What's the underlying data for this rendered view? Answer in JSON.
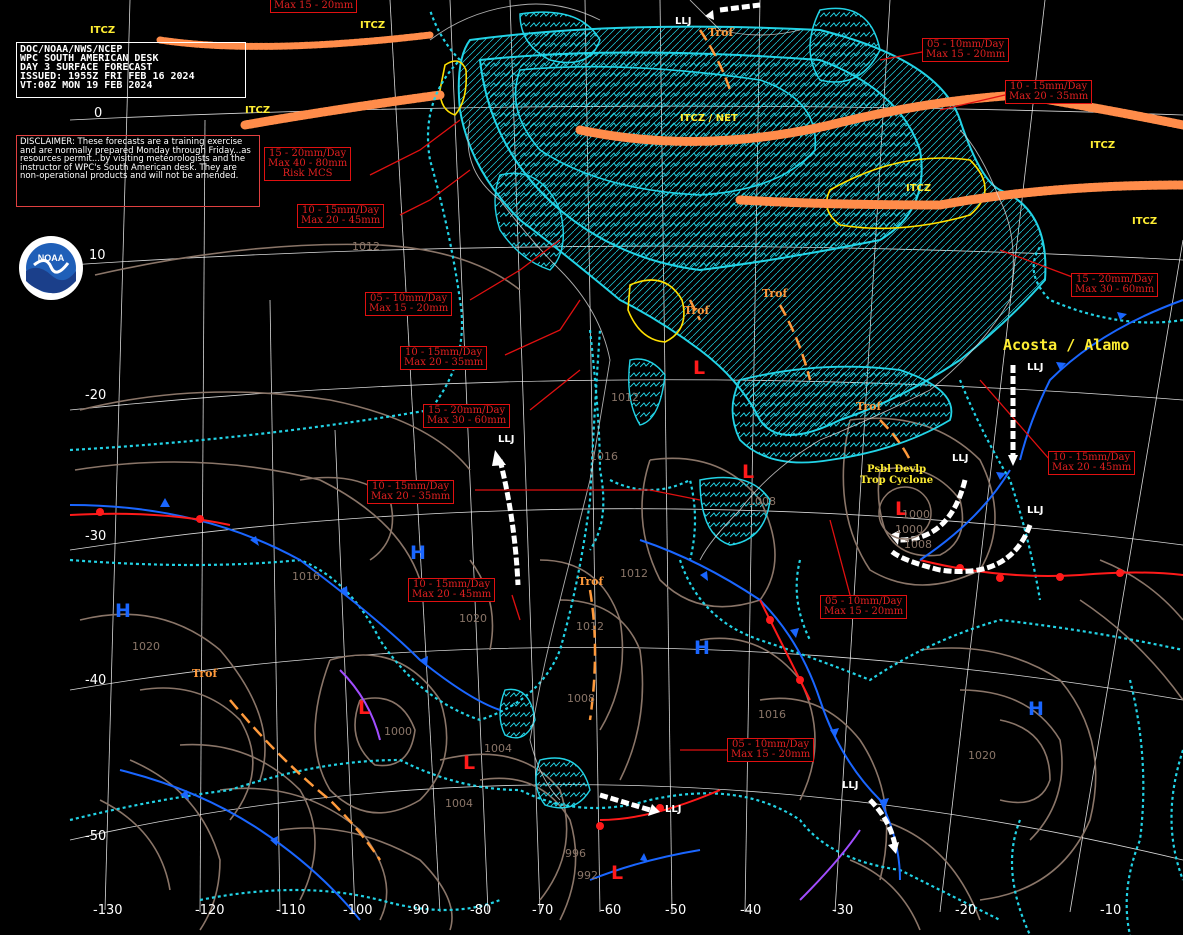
{
  "header": {
    "line1": "DOC/NOAA/NWS/NCEP",
    "line2": "WPC SOUTH AMERICAN DESK",
    "line3": "DAY 3 SURFACE FORECAST",
    "line4": "ISSUED: 1955Z FRI FEB 16 2024",
    "line5": "VT:00Z MON 19 FEB 2024"
  },
  "disclaimer": "DISCLAIMER: These forecasts are a training exercise and are normally prepared Monday through Friday...as resources permit...by visiting meteorologists and the instructor of WPC's South American desk. They are non-operational products and will not be amended.",
  "forecasters": "Acosta / Alamo",
  "rain_boxes": [
    {
      "l1": "15 - 20mm/Day",
      "l2": "Max 40 - 80mm",
      "l3": "Risk MCS"
    },
    {
      "l1": "10 - 15mm/Day",
      "l2": "Max 20 - 45mm"
    },
    {
      "l1": "05 - 10mm/Day",
      "l2": "Max 15 - 20mm"
    },
    {
      "l1": "10 - 15mm/Day",
      "l2": "Max 20 - 35mm"
    },
    {
      "l1": "15 - 20mm/Day",
      "l2": "Max 30 - 60mm"
    },
    {
      "l1": "10 - 15mm/Day",
      "l2": "Max 20 - 35mm"
    },
    {
      "l1": "10 - 15mm/Day",
      "l2": "Max 20 - 45mm"
    },
    {
      "l1": "05 - 10mm/Day",
      "l2": "Max 15 - 20mm"
    },
    {
      "l1": "05 - 10mm/Day",
      "l2": "Max 15 - 20mm"
    },
    {
      "l1": "05 - 10mm/Day",
      "l2": "Max 15 - 20mm"
    },
    {
      "l1": "10 - 15mm/Day",
      "l2": "Max 20 - 35mm"
    },
    {
      "l1": "15 - 20mm/Day",
      "l2": "Max 30 - 60mm"
    },
    {
      "l1": "10 - 15mm/Day",
      "l2": "Max 20 - 45mm"
    },
    {
      "l1": "Max 15 - 20mm"
    }
  ],
  "lat_labels": [
    "0",
    "10",
    "-20",
    "-30",
    "-40",
    "-50"
  ],
  "lon_labels": [
    "-130",
    "-120",
    "-110",
    "-100",
    "-90",
    "-80",
    "-70",
    "-60",
    "-50",
    "-40",
    "-30",
    "-20",
    "-10"
  ],
  "pressure_centers": {
    "high": "H",
    "low": "L"
  },
  "feature_labels": {
    "itcz": "ITCZ",
    "itcz_net": "ITCZ / NET",
    "llj": "LLJ",
    "trof": "Trof",
    "psbl_line1": "Psbl Devlp",
    "psbl_line2": "Trop Cyclone"
  },
  "isobars": [
    "1012",
    "1012",
    "1016",
    "1016",
    "1020",
    "1020",
    "1012",
    "1008",
    "1004",
    "1000",
    "996",
    "992",
    "1016",
    "1020",
    "1012",
    "1008",
    "1004",
    "1000",
    "1000",
    "1008"
  ],
  "colors": {
    "background": "#000000",
    "qpf_outline": "#22d3e6",
    "front_cold": "#1a66ff",
    "front_warm": "#ff1a1a",
    "itcz_band": "#ff8c4a",
    "trough": "#ff9a3c",
    "isobar": "#8a7568",
    "label_yellow": "#ffee33"
  }
}
